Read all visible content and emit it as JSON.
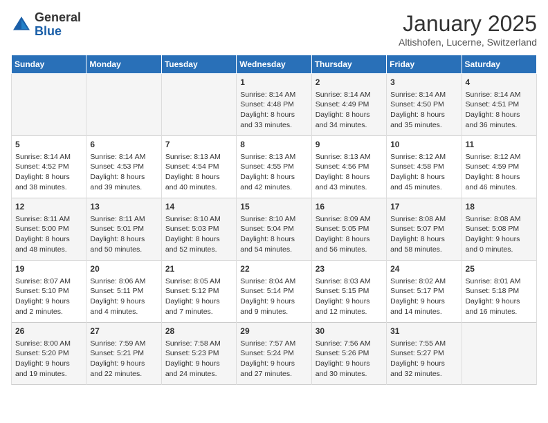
{
  "logo": {
    "general": "General",
    "blue": "Blue"
  },
  "title": "January 2025",
  "location": "Altishofen, Lucerne, Switzerland",
  "weekdays": [
    "Sunday",
    "Monday",
    "Tuesday",
    "Wednesday",
    "Thursday",
    "Friday",
    "Saturday"
  ],
  "weeks": [
    [
      {
        "day": "",
        "info": ""
      },
      {
        "day": "",
        "info": ""
      },
      {
        "day": "",
        "info": ""
      },
      {
        "day": "1",
        "info": "Sunrise: 8:14 AM\nSunset: 4:48 PM\nDaylight: 8 hours\nand 33 minutes."
      },
      {
        "day": "2",
        "info": "Sunrise: 8:14 AM\nSunset: 4:49 PM\nDaylight: 8 hours\nand 34 minutes."
      },
      {
        "day": "3",
        "info": "Sunrise: 8:14 AM\nSunset: 4:50 PM\nDaylight: 8 hours\nand 35 minutes."
      },
      {
        "day": "4",
        "info": "Sunrise: 8:14 AM\nSunset: 4:51 PM\nDaylight: 8 hours\nand 36 minutes."
      }
    ],
    [
      {
        "day": "5",
        "info": "Sunrise: 8:14 AM\nSunset: 4:52 PM\nDaylight: 8 hours\nand 38 minutes."
      },
      {
        "day": "6",
        "info": "Sunrise: 8:14 AM\nSunset: 4:53 PM\nDaylight: 8 hours\nand 39 minutes."
      },
      {
        "day": "7",
        "info": "Sunrise: 8:13 AM\nSunset: 4:54 PM\nDaylight: 8 hours\nand 40 minutes."
      },
      {
        "day": "8",
        "info": "Sunrise: 8:13 AM\nSunset: 4:55 PM\nDaylight: 8 hours\nand 42 minutes."
      },
      {
        "day": "9",
        "info": "Sunrise: 8:13 AM\nSunset: 4:56 PM\nDaylight: 8 hours\nand 43 minutes."
      },
      {
        "day": "10",
        "info": "Sunrise: 8:12 AM\nSunset: 4:58 PM\nDaylight: 8 hours\nand 45 minutes."
      },
      {
        "day": "11",
        "info": "Sunrise: 8:12 AM\nSunset: 4:59 PM\nDaylight: 8 hours\nand 46 minutes."
      }
    ],
    [
      {
        "day": "12",
        "info": "Sunrise: 8:11 AM\nSunset: 5:00 PM\nDaylight: 8 hours\nand 48 minutes."
      },
      {
        "day": "13",
        "info": "Sunrise: 8:11 AM\nSunset: 5:01 PM\nDaylight: 8 hours\nand 50 minutes."
      },
      {
        "day": "14",
        "info": "Sunrise: 8:10 AM\nSunset: 5:03 PM\nDaylight: 8 hours\nand 52 minutes."
      },
      {
        "day": "15",
        "info": "Sunrise: 8:10 AM\nSunset: 5:04 PM\nDaylight: 8 hours\nand 54 minutes."
      },
      {
        "day": "16",
        "info": "Sunrise: 8:09 AM\nSunset: 5:05 PM\nDaylight: 8 hours\nand 56 minutes."
      },
      {
        "day": "17",
        "info": "Sunrise: 8:08 AM\nSunset: 5:07 PM\nDaylight: 8 hours\nand 58 minutes."
      },
      {
        "day": "18",
        "info": "Sunrise: 8:08 AM\nSunset: 5:08 PM\nDaylight: 9 hours\nand 0 minutes."
      }
    ],
    [
      {
        "day": "19",
        "info": "Sunrise: 8:07 AM\nSunset: 5:10 PM\nDaylight: 9 hours\nand 2 minutes."
      },
      {
        "day": "20",
        "info": "Sunrise: 8:06 AM\nSunset: 5:11 PM\nDaylight: 9 hours\nand 4 minutes."
      },
      {
        "day": "21",
        "info": "Sunrise: 8:05 AM\nSunset: 5:12 PM\nDaylight: 9 hours\nand 7 minutes."
      },
      {
        "day": "22",
        "info": "Sunrise: 8:04 AM\nSunset: 5:14 PM\nDaylight: 9 hours\nand 9 minutes."
      },
      {
        "day": "23",
        "info": "Sunrise: 8:03 AM\nSunset: 5:15 PM\nDaylight: 9 hours\nand 12 minutes."
      },
      {
        "day": "24",
        "info": "Sunrise: 8:02 AM\nSunset: 5:17 PM\nDaylight: 9 hours\nand 14 minutes."
      },
      {
        "day": "25",
        "info": "Sunrise: 8:01 AM\nSunset: 5:18 PM\nDaylight: 9 hours\nand 16 minutes."
      }
    ],
    [
      {
        "day": "26",
        "info": "Sunrise: 8:00 AM\nSunset: 5:20 PM\nDaylight: 9 hours\nand 19 minutes."
      },
      {
        "day": "27",
        "info": "Sunrise: 7:59 AM\nSunset: 5:21 PM\nDaylight: 9 hours\nand 22 minutes."
      },
      {
        "day": "28",
        "info": "Sunrise: 7:58 AM\nSunset: 5:23 PM\nDaylight: 9 hours\nand 24 minutes."
      },
      {
        "day": "29",
        "info": "Sunrise: 7:57 AM\nSunset: 5:24 PM\nDaylight: 9 hours\nand 27 minutes."
      },
      {
        "day": "30",
        "info": "Sunrise: 7:56 AM\nSunset: 5:26 PM\nDaylight: 9 hours\nand 30 minutes."
      },
      {
        "day": "31",
        "info": "Sunrise: 7:55 AM\nSunset: 5:27 PM\nDaylight: 9 hours\nand 32 minutes."
      },
      {
        "day": "",
        "info": ""
      }
    ]
  ]
}
